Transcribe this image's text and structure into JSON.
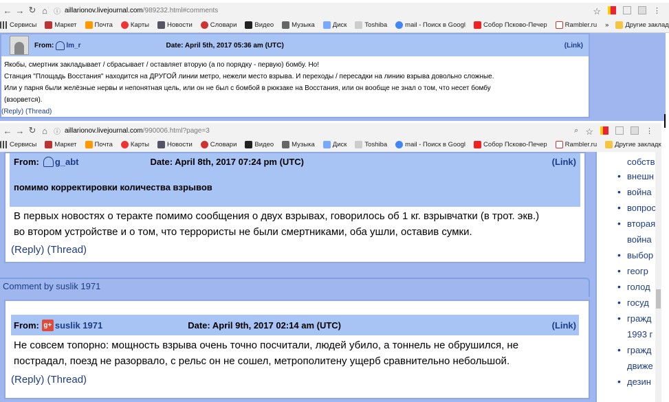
{
  "top_window": {
    "url_host": "aillarionov.livejournal.com",
    "url_path": "/989232.html#comments",
    "bookmarks": [
      "Сервисы",
      "Маркет",
      "Почта",
      "Карты",
      "Новости",
      "Словари",
      "Видео",
      "Музыка",
      "Диск",
      "Toshiba",
      "mail - Поиск в Googl",
      "Собор Псково-Печер",
      "Rambler.ru"
    ],
    "other_bookmarks": "Другие закладки",
    "comment": {
      "from_label": "From:",
      "user": "lm_r",
      "date": "Date: April 5th, 2017 05:36 am (UTC)",
      "link": "(Link)",
      "lines": [
        "Якобы, смертник закладывает / сбрасывает / оставляет вторую (а по порядку - первую) бомбу. Но!",
        "Станция \"Площадь Восстания\" находится на ДРУГОЙ линии метро, нежели место взрыва. И переходы / пересадки на линию взрыва довольно сложные.",
        "Или у парня были желёзные нервы и непонятная цель, или он не был с бомбой в рюкзаке на Восстания, или он вообще не знал о том, что несет бомбу",
        "(взорвется)."
      ],
      "reply": "(Reply)",
      "thread": "(Thread)"
    }
  },
  "bottom_window": {
    "url_host": "aillarionov.livejournal.com",
    "url_path": "/990006.html?page=3",
    "bookmarks": [
      "Сервисы",
      "Маркет",
      "Почта",
      "Карты",
      "Новости",
      "Словари",
      "Видео",
      "Музыка",
      "Диск",
      "Toshiba",
      "mail - Поиск в Googl",
      "Собор Псково-Печер",
      "Rambler.ru"
    ],
    "other_bookmarks": "Другие закладки",
    "comment1": {
      "from_label": "From:",
      "user": "g_abt",
      "date": "Date: April 8th, 2017 07:24 pm (UTC)",
      "link": "(Link)",
      "subject": "помимо корректировки количества взрывов",
      "lines": [
        "В первых новостях о теракте помимо сообщения о двух взрывах, говорилось об 1 кг. взрывчатки (в трот. экв.)",
        "во втором устройстве и о том, что террористы не были смертниками, оба ушли, оставив сумки."
      ],
      "reply": "(Reply)",
      "thread": "(Thread)"
    },
    "comment_by": "Comment by suslik 1971",
    "comment2": {
      "from_label": "From:",
      "user": "suslik 1971",
      "date": "Date: April 9th, 2017 02:14 am (UTC)",
      "link": "(Link)",
      "lines": [
        "Не совсем топорно: мощность взрыва очень точно посчитали, людей убило, а тоннель не обрушился, не",
        "пострадал, поезд не разорвало, с рельс он не сошел, метрополитену ущерб сравнительно небольшой."
      ],
      "reply": "(Reply)",
      "thread": "(Thread)"
    },
    "sidebar": {
      "partial_top": "собств",
      "items": [
        "внешн",
        "война",
        "вопрос",
        "вторая",
        "война",
        "выбор",
        "геогр",
        "голод",
        "госуд",
        "гражд",
        "1993 г",
        "гражд",
        "движе",
        "дезин"
      ]
    }
  },
  "colors": {
    "panel_blue": "#9fb7ee",
    "header_blue": "#a8c4f4",
    "link": "#1d3c86"
  }
}
